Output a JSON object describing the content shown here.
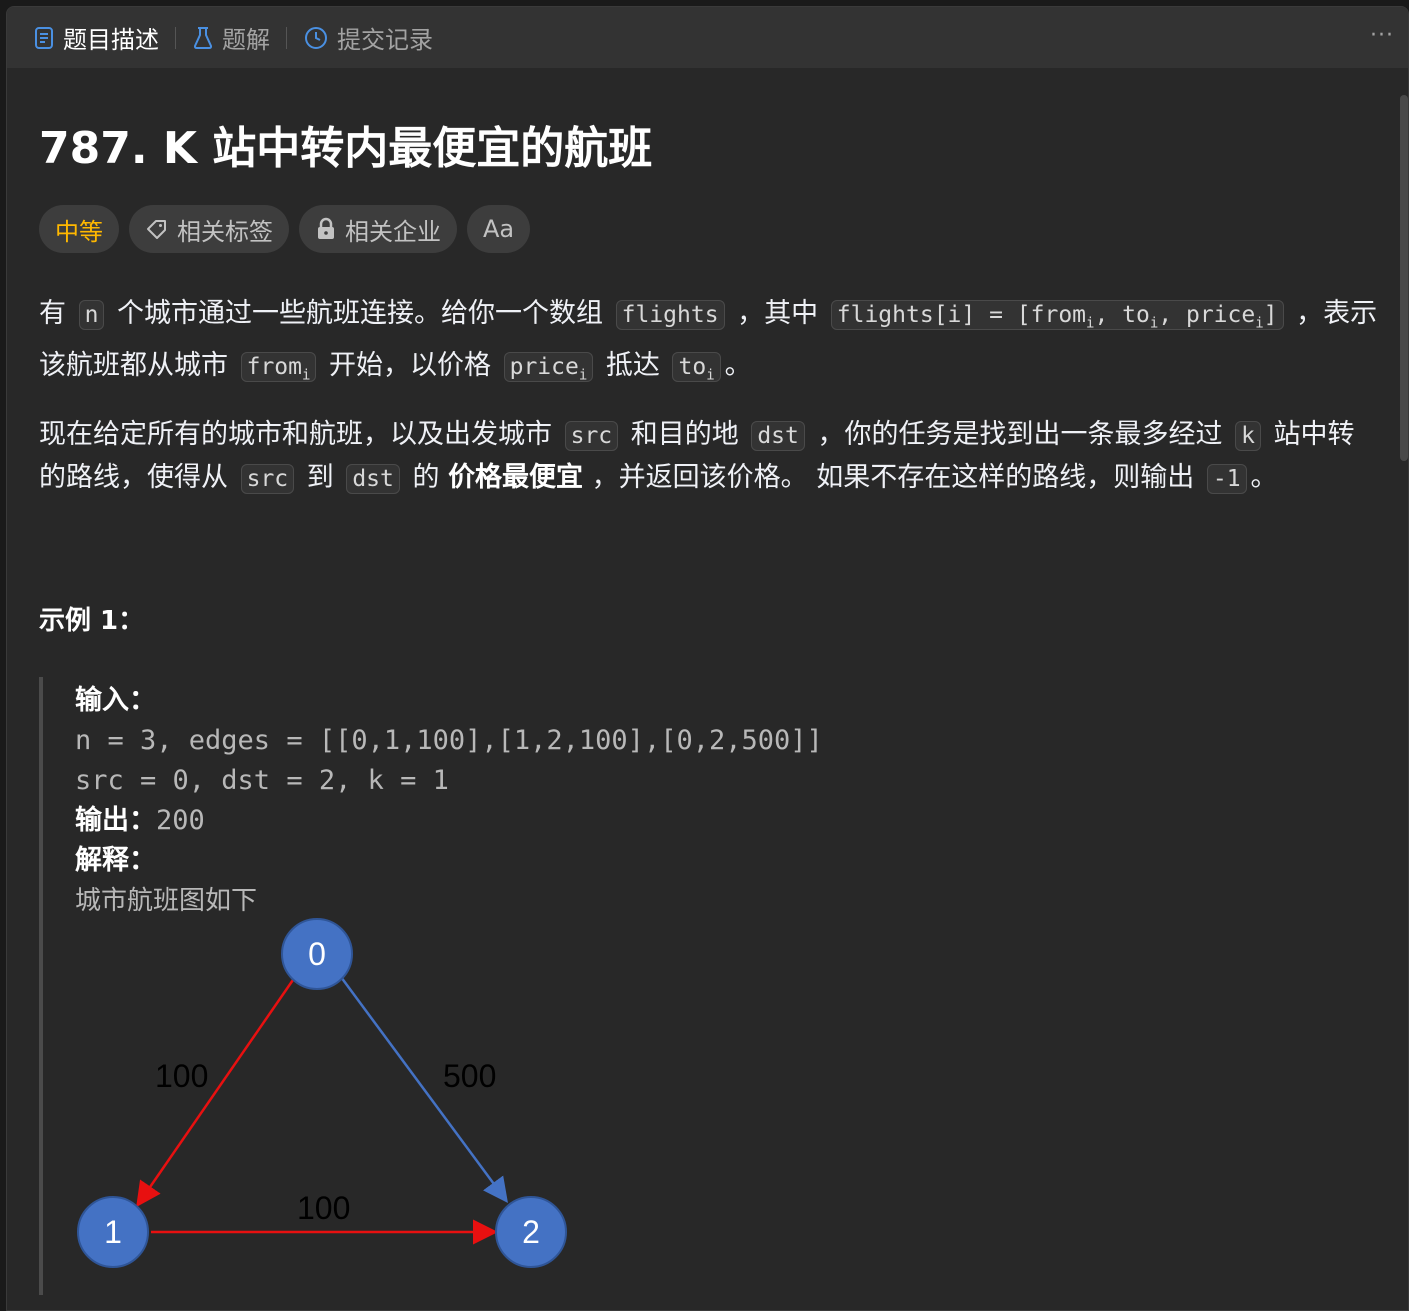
{
  "tabs": [
    {
      "label": "题目描述",
      "icon": "description-icon",
      "active": true
    },
    {
      "label": "题解",
      "icon": "flask-icon",
      "active": false
    },
    {
      "label": "提交记录",
      "icon": "history-icon",
      "active": false
    }
  ],
  "more_label": "···",
  "problem": {
    "title": "787. K 站中转内最便宜的航班",
    "difficulty": "中等",
    "tags_label": "相关标签",
    "companies_label": "相关企业",
    "translate_label": "Aa"
  },
  "desc": {
    "p1_a": "有",
    "code_n": "n",
    "p1_b": "个城市通过一些航班连接。给你一个数组",
    "code_flights": "flights",
    "p1_c": "，其中",
    "code_flights_i": "flights[i] = [from",
    "sub_i": "i",
    "code_to": ", to",
    "code_price": ", price",
    "code_close": "]",
    "p1_d": "，表示该航班都从城市",
    "code_from": "from",
    "p1_e": "开始，以价格",
    "code_price2": "price",
    "p1_f": "抵达",
    "code_to2": "to",
    "p1_g": "。",
    "p2_a": "现在给定所有的城市和航班，以及出发城市",
    "code_src": "src",
    "p2_b": "和目的地",
    "code_dst": "dst",
    "p2_c": "，你的任务是找到出一条最多经过",
    "code_k": "k",
    "p2_d": "站中转的路线，使得从",
    "p2_e": "到",
    "p2_f": "的",
    "p2_strong": "价格最便宜",
    "p2_g": "，并返回该价格。 如果不存在这样的路线，则输出",
    "code_neg1": "-1",
    "p2_h": "。"
  },
  "example": {
    "title": "示例 1：",
    "input_label": "输入：",
    "input_line1": "n = 3, edges = [[0,1,100],[1,2,100],[0,2,500]]",
    "input_line2": "src = 0, dst = 2, k = 1",
    "output_label": "输出：",
    "output_value": "200",
    "explain_label": "解释：",
    "explain_text": "城市航班图如下"
  },
  "graph": {
    "nodes": [
      "0",
      "1",
      "2"
    ],
    "edges": [
      {
        "from": "0",
        "to": "1",
        "label": "100",
        "color": "#e81010"
      },
      {
        "from": "0",
        "to": "2",
        "label": "500",
        "color": "#4472c4"
      },
      {
        "from": "1",
        "to": "2",
        "label": "100",
        "color": "#e81010"
      }
    ],
    "node_color": "#4472c4"
  }
}
